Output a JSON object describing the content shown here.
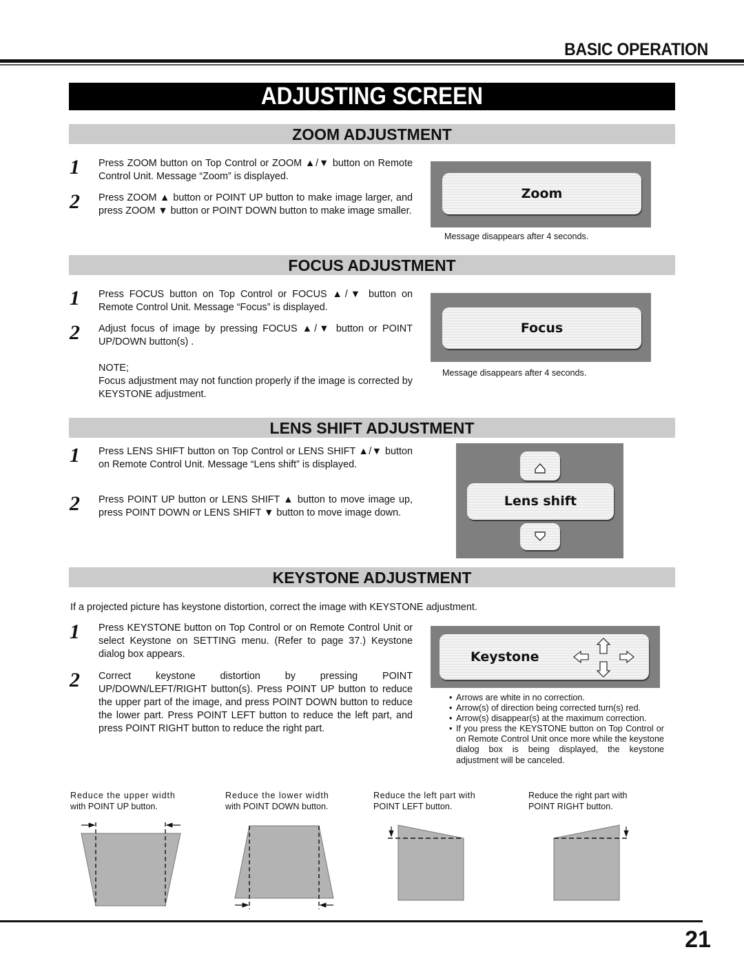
{
  "header": {
    "section_label": "BASIC OPERATION",
    "page_title": "ADJUSTING SCREEN"
  },
  "zoom": {
    "heading": "ZOOM ADJUSTMENT",
    "steps": [
      {
        "num": "1",
        "text": "Press ZOOM button on Top Control or ZOOM ▲/▼ button on Remote Control Unit.  Message “Zoom” is displayed."
      },
      {
        "num": "2",
        "text": "Press ZOOM ▲ button or POINT UP button to make image larger, and press ZOOM ▼ button or POINT DOWN button to make image smaller."
      }
    ],
    "osd_label": "Zoom",
    "caption": "Message disappears after 4 seconds."
  },
  "focus": {
    "heading": "FOCUS ADJUSTMENT",
    "steps": [
      {
        "num": "1",
        "text": "Press FOCUS button on Top Control or FOCUS ▲/▼ button on Remote Control Unit.  Message “Focus” is displayed."
      },
      {
        "num": "2",
        "text": "Adjust focus of image by pressing FOCUS ▲/▼  button or POINT UP/DOWN button(s) ."
      }
    ],
    "note_label": "NOTE;",
    "note_text": "Focus adjustment may not function properly if the image is corrected by KEYSTONE adjustment.",
    "osd_label": "Focus",
    "caption": "Message disappears after 4 seconds."
  },
  "lens_shift": {
    "heading": "LENS SHIFT ADJUSTMENT",
    "steps": [
      {
        "num": "1",
        "text": "Press LENS SHIFT button on Top Control or LENS SHIFT ▲/▼ button on Remote Control Unit. Message “Lens shift” is displayed."
      },
      {
        "num": "2",
        "text": "Press POINT UP button or LENS SHIFT ▲ button to move image up, press POINT DOWN or LENS SHIFT ▼ button to move image down."
      }
    ],
    "osd_label": "Lens shift",
    "icons": {
      "up": "up-triangle-icon",
      "down": "down-triangle-icon"
    }
  },
  "keystone": {
    "heading": "KEYSTONE ADJUSTMENT",
    "intro": "If a projected picture has keystone distortion, correct the image with KEYSTONE adjustment.",
    "steps": [
      {
        "num": "1",
        "text": "Press KEYSTONE button on Top Control or on Remote Control Unit or select Keystone on SETTING menu.  (Refer to page 37.) Keystone dialog box appears."
      },
      {
        "num": "2",
        "text": "Correct keystone distortion by pressing POINT UP/DOWN/LEFT/RIGHT button(s).  Press POINT UP button to reduce the upper part of the image, and press POINT DOWN button to reduce the lower part.  Press POINT LEFT button to reduce the left part, and press POINT RIGHT button to reduce the right part."
      }
    ],
    "osd_label": "Keystone",
    "osd_icons": [
      "left-arrow-icon",
      "up-arrow-icon",
      "down-arrow-icon",
      "right-arrow-icon"
    ],
    "bullets": [
      "Arrows are white in no correction.",
      "Arrow(s) of direction being corrected turn(s) red.",
      "Arrow(s) disappear(s) at the maximum correction.",
      "If you press the KEYSTONE button on Top Control or on Remote Control Unit once more while the keystone dialog box is being displayed, the keystone adjustment will be canceled."
    ],
    "diagrams": [
      {
        "line1": "Reduce the upper width",
        "line2": "with POINT UP button."
      },
      {
        "line1": "Reduce the lower width",
        "line2": "with POINT DOWN button."
      },
      {
        "line1": "Reduce the left part with",
        "line2": "POINT LEFT button."
      },
      {
        "line1": "Reduce the right part with",
        "line2": "POINT RIGHT button."
      }
    ]
  },
  "footer": {
    "page_number": "21"
  }
}
